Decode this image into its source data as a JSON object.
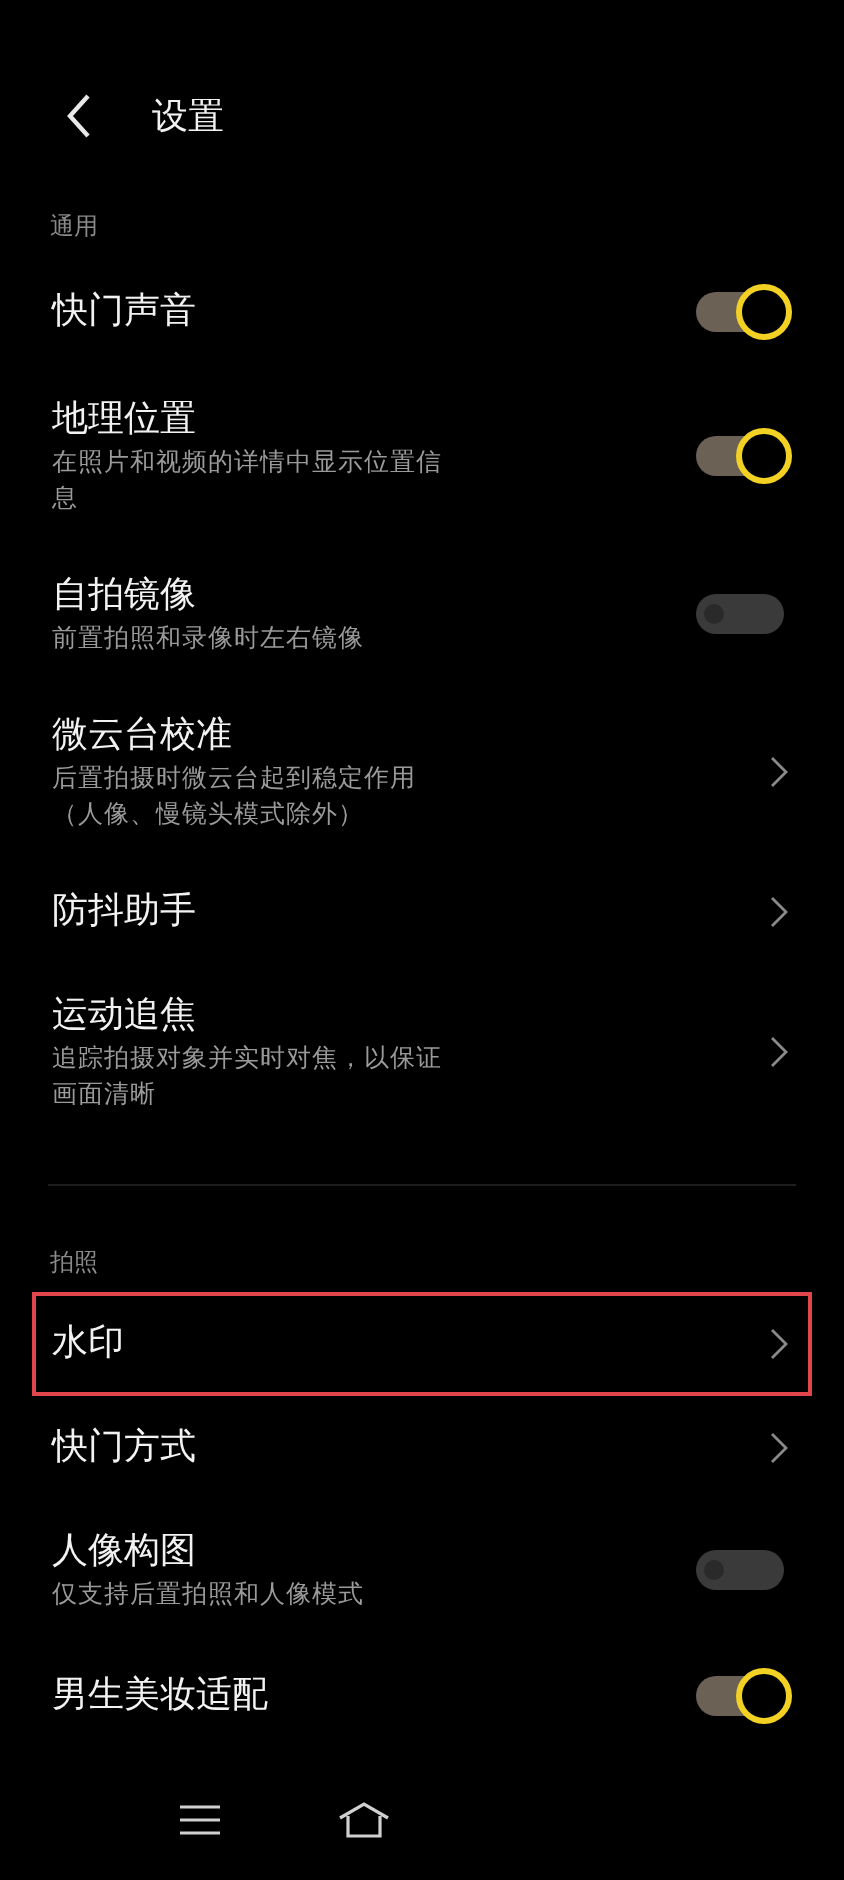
{
  "header": {
    "title": "设置"
  },
  "sections": [
    {
      "label": "通用",
      "rows": [
        {
          "kind": "toggle",
          "title": "快门声音",
          "on": true,
          "highlighted": false
        },
        {
          "kind": "toggle",
          "title": "地理位置",
          "subtitle": "在照片和视频的详情中显示位置信息",
          "on": true,
          "highlighted": false
        },
        {
          "kind": "toggle",
          "title": "自拍镜像",
          "subtitle": "前置拍照和录像时左右镜像",
          "on": false,
          "highlighted": false
        },
        {
          "kind": "link",
          "title": "微云台校准",
          "subtitle": "后置拍摄时微云台起到稳定作用（人像、慢镜头模式除外）",
          "highlighted": false
        },
        {
          "kind": "link",
          "title": "防抖助手",
          "highlighted": false
        },
        {
          "kind": "link",
          "title": "运动追焦",
          "subtitle": "追踪拍摄对象并实时对焦，以保证画面清晰",
          "highlighted": false
        }
      ]
    },
    {
      "label": "拍照",
      "rows": [
        {
          "kind": "link",
          "title": "水印",
          "highlighted": true
        },
        {
          "kind": "link",
          "title": "快门方式",
          "highlighted": false
        },
        {
          "kind": "toggle",
          "title": "人像构图",
          "subtitle": "仅支持后置拍照和人像模式",
          "on": false,
          "highlighted": false
        },
        {
          "kind": "toggle",
          "title": "男生美妆适配",
          "on": true,
          "highlighted": false
        }
      ]
    }
  ]
}
